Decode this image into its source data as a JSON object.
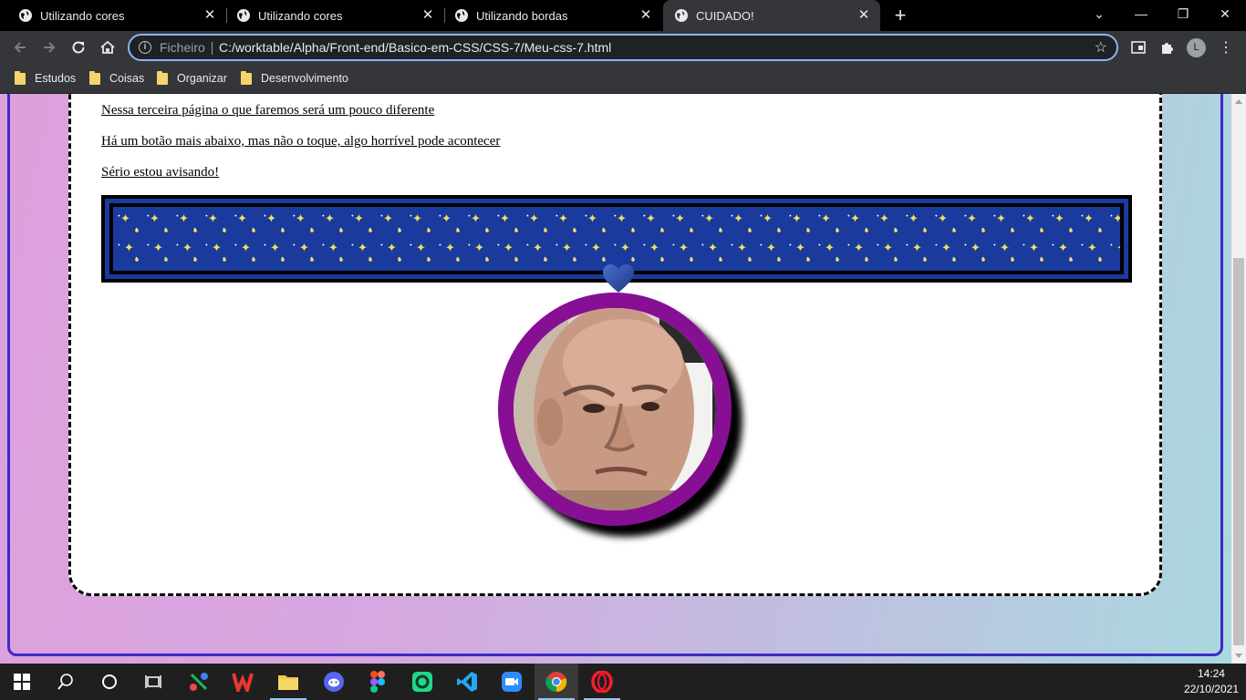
{
  "browser": {
    "tabs": [
      {
        "label": "Utilizando cores",
        "active": false
      },
      {
        "label": "Utilizando cores",
        "active": false
      },
      {
        "label": "Utilizando bordas",
        "active": false
      },
      {
        "label": "CUIDADO!",
        "active": true
      }
    ],
    "address": {
      "chip": "Ficheiro",
      "url": "C:/worktable/Alpha/Front-end/Basico-em-CSS/CSS-7/Meu-css-7.html"
    },
    "avatar_initial": "L",
    "bookmarks": [
      "Estudos",
      "Coisas",
      "Organizar",
      "Desenvolvimento"
    ]
  },
  "page": {
    "lines": [
      "Nessa terceira página o que faremos será um pouco diferente",
      "Há um botão mais abaixo, mas não o toque, algo horrível pode acontecer",
      "Sério estou avisando!"
    ],
    "colors": {
      "background_gradient": [
        "#dda0dd",
        "#aad8e0"
      ],
      "frame_border": "#3b2bc8",
      "star_panel": "#1a3a9e",
      "star": "#f1e05a",
      "portrait_ring": "#870f94",
      "heart": "#2f4fa8"
    }
  },
  "taskbar": {
    "apps": [
      "windows-start",
      "search",
      "cortana",
      "task-view",
      "gitkraken",
      "wps-office",
      "file-explorer",
      "discord",
      "figma",
      "pycharm-edu",
      "vs-code",
      "zoom",
      "chrome",
      "opera"
    ],
    "time": "14:24",
    "date": "22/10/2021"
  }
}
